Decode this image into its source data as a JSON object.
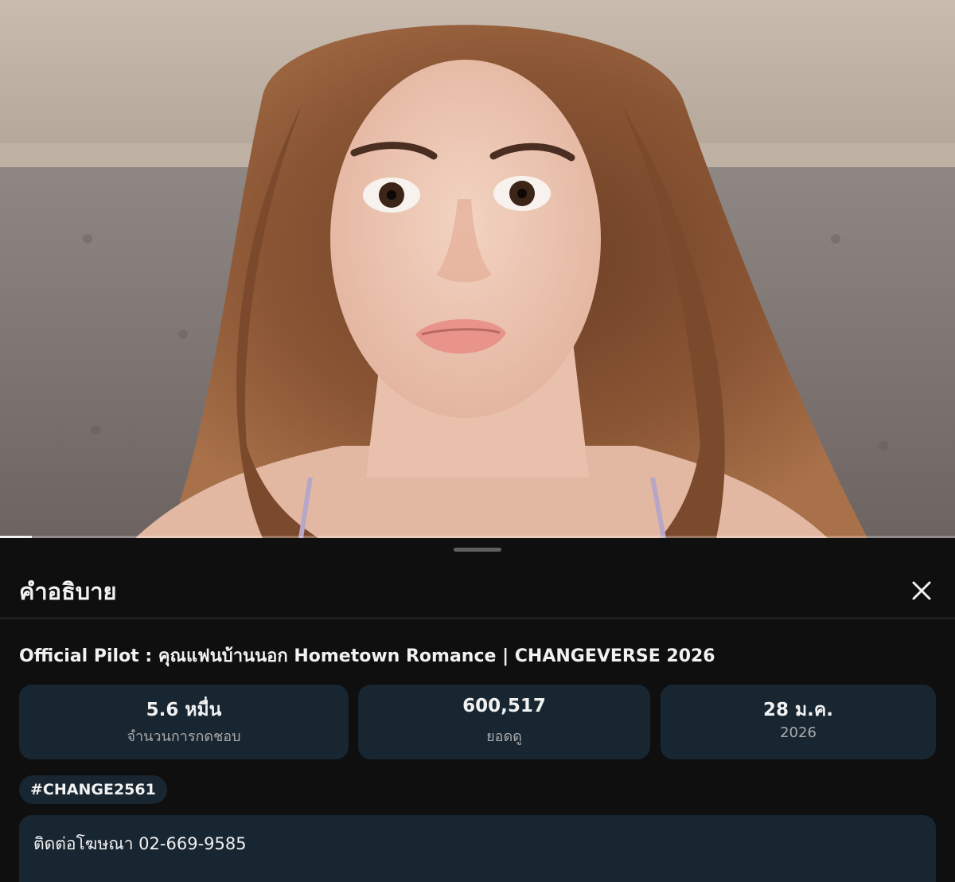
{
  "player": {
    "progress_fraction": 0.033
  },
  "sheet": {
    "title": "คำอธิบาย",
    "close_icon": "close-icon"
  },
  "video": {
    "title": "Official Pilot : คุณแฟนบ้านนอก Hometown Romance | CHANGEVERSE 2026"
  },
  "stats": {
    "likes": {
      "value": "5.6 หมื่น",
      "label": "จำนวนการกดชอบ"
    },
    "views": {
      "value": "600,517",
      "label": "ยอดดู"
    },
    "date": {
      "value": "28 ม.ค.",
      "label": "2026"
    }
  },
  "hashtag": "#CHANGE2561",
  "description": {
    "text": "ติดต่อโฆษณา 02-669-9585"
  },
  "colors": {
    "background": "#0f0f0f",
    "card": "#182631",
    "text_primary": "#f1f1f1",
    "text_secondary": "#aaaaaa"
  }
}
